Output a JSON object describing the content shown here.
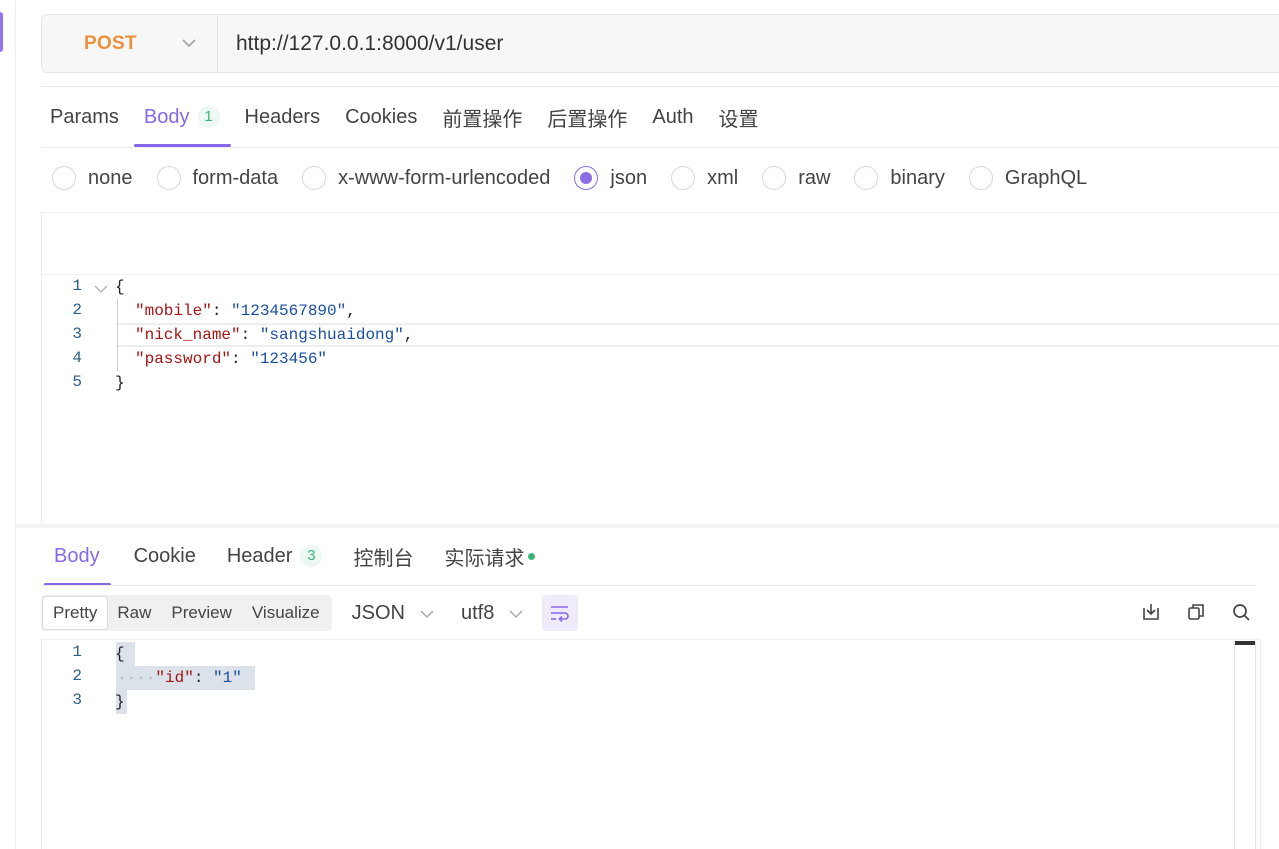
{
  "request": {
    "method": "POST",
    "url": "http://127.0.0.1:8000/v1/user"
  },
  "request_tabs": [
    {
      "label": "Params"
    },
    {
      "label": "Body",
      "badge": "1"
    },
    {
      "label": "Headers"
    },
    {
      "label": "Cookies"
    },
    {
      "label": "前置操作"
    },
    {
      "label": "后置操作"
    },
    {
      "label": "Auth"
    },
    {
      "label": "设置"
    }
  ],
  "body_types": [
    "none",
    "form-data",
    "x-www-form-urlencoded",
    "json",
    "xml",
    "raw",
    "binary",
    "GraphQL"
  ],
  "body_type_selected": "json",
  "request_body": {
    "line_numbers": [
      "1",
      "2",
      "3",
      "4",
      "5"
    ],
    "open_brace": "{",
    "close_brace": "}",
    "fields": [
      {
        "key": "\"mobile\"",
        "value": "\"1234567890\"",
        "sep": ","
      },
      {
        "key": "\"nick_name\"",
        "value": "\"sangshuaidong\"",
        "sep": ","
      },
      {
        "key": "\"password\"",
        "value": "\"123456\"",
        "sep": ""
      }
    ]
  },
  "response_tabs": [
    {
      "label": "Body"
    },
    {
      "label": "Cookie"
    },
    {
      "label": "Header",
      "badge": "3"
    },
    {
      "label": "控制台"
    },
    {
      "label": "实际请求"
    }
  ],
  "view_modes": [
    "Pretty",
    "Raw",
    "Preview",
    "Visualize"
  ],
  "view_mode_selected": "Pretty",
  "format": "JSON",
  "encoding": "utf8",
  "response_body": {
    "line_numbers": [
      "1",
      "2",
      "3"
    ],
    "open_brace": "{",
    "close_brace": "}",
    "key": "\"id\"",
    "value": "\"1\"",
    "indent_dots": "····"
  },
  "colors": {
    "accent": "#8868e6",
    "method": "#ee8f3b",
    "badge_green": "#3bb37a"
  }
}
